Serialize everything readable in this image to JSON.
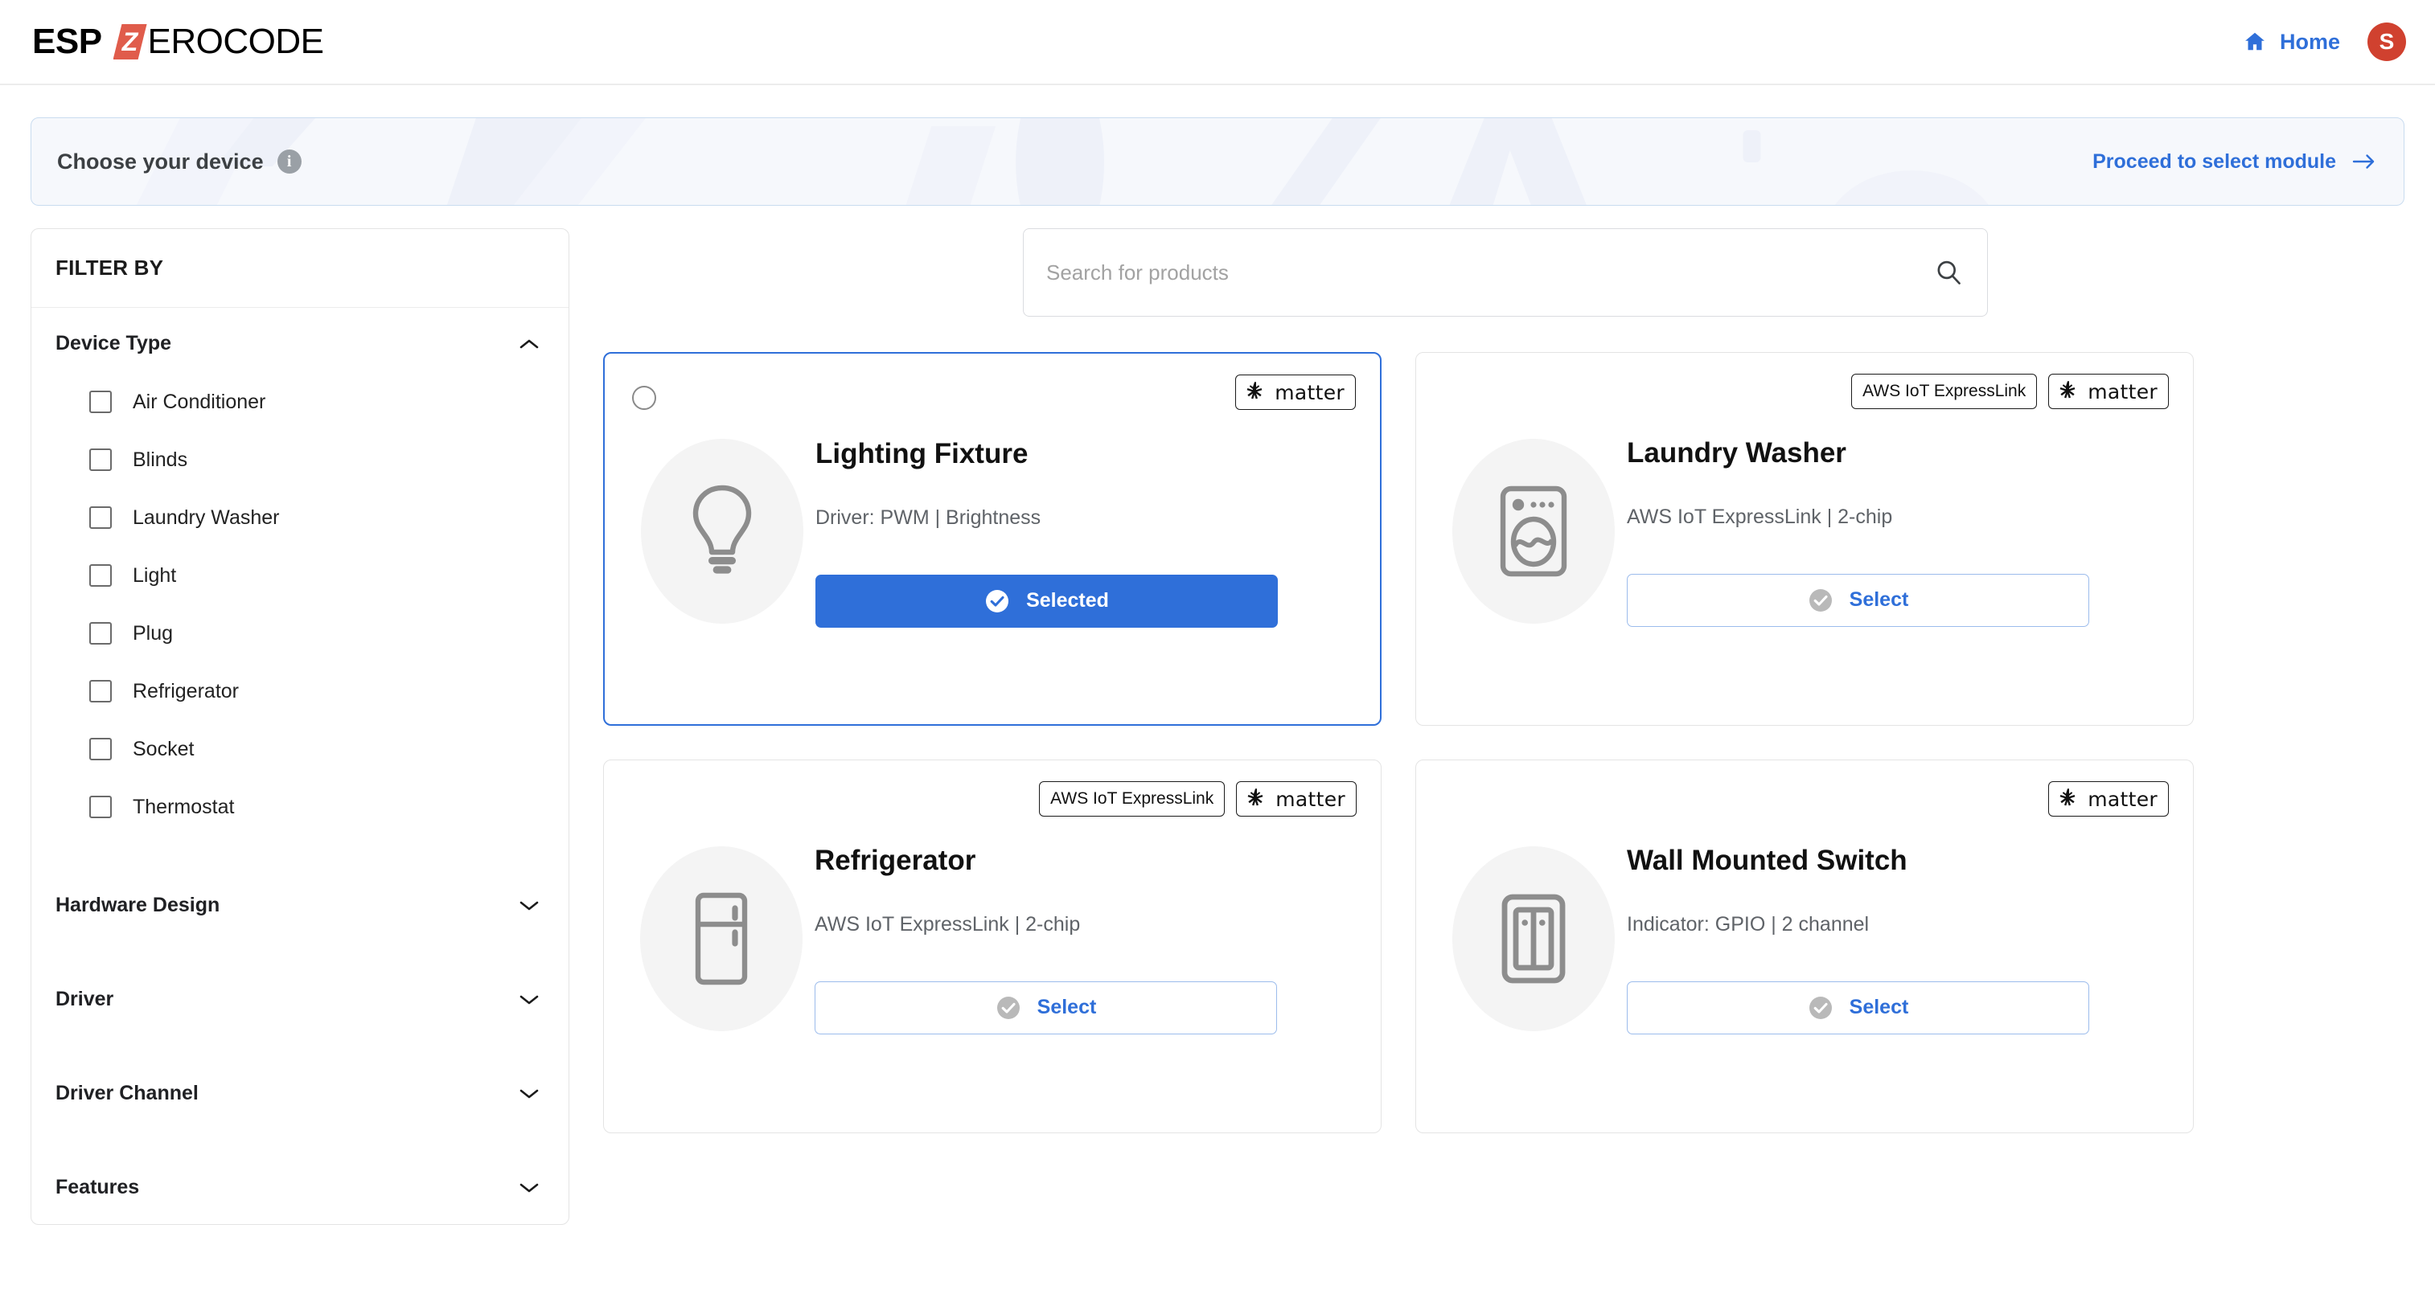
{
  "brand": {
    "logo_bold": "ESP",
    "logo_mark_letter": "Z",
    "logo_rest": "EROCODE"
  },
  "header": {
    "home_label": "Home",
    "home_icon": "home-icon",
    "avatar_initial": "S",
    "avatar_color": "#d0412f",
    "accent_color": "#2f6fd9"
  },
  "banner": {
    "title": "Choose your device",
    "info_icon": "info-icon",
    "info_glyph": "i",
    "cta_label": "Proceed to select module",
    "cta_icon": "arrow-right-icon"
  },
  "search": {
    "placeholder": "Search for products",
    "value": "",
    "icon": "search-icon"
  },
  "sidebar": {
    "title": "FILTER BY",
    "facets": [
      {
        "label": "Device Type",
        "expanded": true,
        "chevron": "chevron-up-icon",
        "options": [
          {
            "label": "Air Conditioner",
            "checked": false
          },
          {
            "label": "Blinds",
            "checked": false
          },
          {
            "label": "Laundry Washer",
            "checked": false
          },
          {
            "label": "Light",
            "checked": false
          },
          {
            "label": "Plug",
            "checked": false
          },
          {
            "label": "Refrigerator",
            "checked": false
          },
          {
            "label": "Socket",
            "checked": false
          },
          {
            "label": "Thermostat",
            "checked": false
          }
        ]
      },
      {
        "label": "Hardware Design",
        "expanded": false,
        "chevron": "chevron-down-icon",
        "options": []
      },
      {
        "label": "Driver",
        "expanded": false,
        "chevron": "chevron-down-icon",
        "options": []
      },
      {
        "label": "Driver Channel",
        "expanded": false,
        "chevron": "chevron-down-icon",
        "options": []
      },
      {
        "label": "Features",
        "expanded": false,
        "chevron": "chevron-down-icon",
        "options": []
      }
    ]
  },
  "products": [
    {
      "title": "Lighting Fixture",
      "subtitle": "Driver: PWM | Brightness",
      "badges": [
        "matter"
      ],
      "badge_matter_label": "matter",
      "badge_express_label": "AWS IoT ExpressLink",
      "icon": "lightbulb-icon",
      "selected": true,
      "button_label": "Selected",
      "radio_checked": false
    },
    {
      "title": "Laundry Washer",
      "subtitle": "AWS IoT ExpressLink | 2-chip",
      "badges": [
        "express",
        "matter"
      ],
      "badge_matter_label": "matter",
      "badge_express_label": "AWS IoT ExpressLink",
      "icon": "washer-icon",
      "selected": false,
      "button_label": "Select",
      "radio_checked": false
    },
    {
      "title": "Refrigerator",
      "subtitle": "AWS IoT ExpressLink | 2-chip",
      "badges": [
        "express",
        "matter"
      ],
      "badge_matter_label": "matter",
      "badge_express_label": "AWS IoT ExpressLink",
      "icon": "refrigerator-icon",
      "selected": false,
      "button_label": "Select",
      "radio_checked": false
    },
    {
      "title": "Wall Mounted Switch",
      "subtitle": "Indicator: GPIO | 2 channel",
      "badges": [
        "matter"
      ],
      "badge_matter_label": "matter",
      "badge_express_label": "AWS IoT ExpressLink",
      "icon": "wall-switch-icon",
      "selected": false,
      "button_label": "Select",
      "radio_checked": false
    }
  ]
}
